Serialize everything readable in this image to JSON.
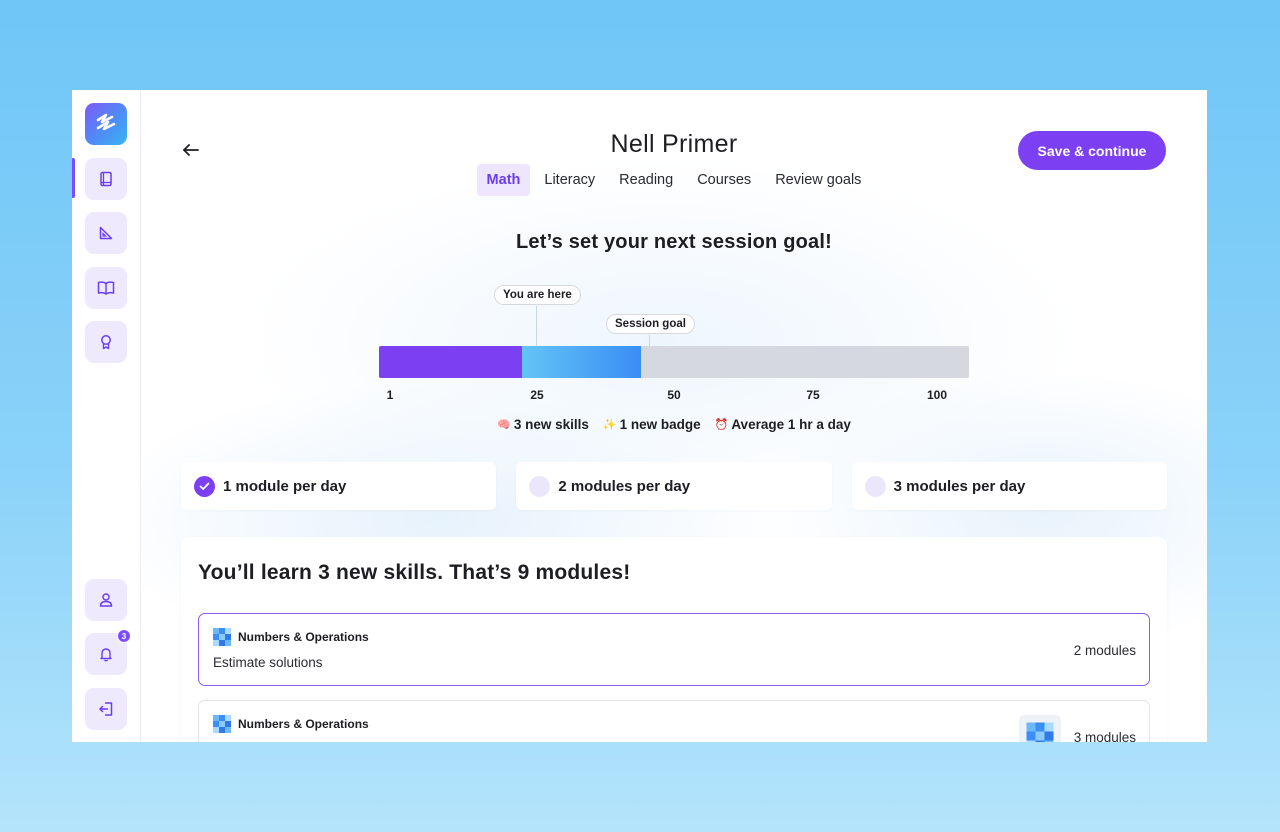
{
  "sidebar": {
    "items": [
      {
        "icon": "book-icon"
      },
      {
        "icon": "ruler-triangle-icon"
      },
      {
        "icon": "open-book-icon"
      },
      {
        "icon": "award-icon"
      }
    ],
    "bottom": [
      {
        "icon": "user-icon"
      },
      {
        "icon": "bell-icon",
        "badge": "3"
      },
      {
        "icon": "logout-icon"
      }
    ]
  },
  "header": {
    "title": "Nell Primer",
    "tabs": [
      {
        "label": "Math",
        "active": true
      },
      {
        "label": "Literacy"
      },
      {
        "label": "Reading"
      },
      {
        "label": "Courses"
      },
      {
        "label": "Review goals"
      }
    ],
    "save_label": "Save & continue"
  },
  "goal": {
    "heading": "Let’s set your next session goal!",
    "you_are_here_label": "You are here",
    "session_goal_label": "Session goal",
    "current": 25,
    "goal": 45,
    "scale_min": 1,
    "scale_max": 100,
    "ticks": [
      "1",
      "25",
      "50",
      "75",
      "100"
    ],
    "stats": [
      {
        "emoji": "🧠",
        "text": "3 new skills"
      },
      {
        "emoji": "✨",
        "text": "1 new badge"
      },
      {
        "emoji": "⏰",
        "text": "Average 1 hr a day"
      }
    ]
  },
  "options": [
    {
      "label": "1 module per day",
      "checked": true
    },
    {
      "label": "2 modules per day",
      "checked": false
    },
    {
      "label": "3 modules per day",
      "checked": false
    }
  ],
  "summary": {
    "title": "You’ll learn 3 new skills. That’s 9 modules!",
    "skills": [
      {
        "category": "Numbers & Operations",
        "name": "Estimate solutions",
        "count": "2 modules",
        "selected": true
      },
      {
        "category": "Numbers & Operations",
        "name": "",
        "count": "3 modules",
        "selected": false
      }
    ]
  },
  "colors": {
    "accent": "#7c3ff2",
    "accent_light": "#ede6fe",
    "goal_gradient_start": "#64c4f7",
    "goal_gradient_end": "#3a8ef5",
    "track": "#d5d8de"
  }
}
